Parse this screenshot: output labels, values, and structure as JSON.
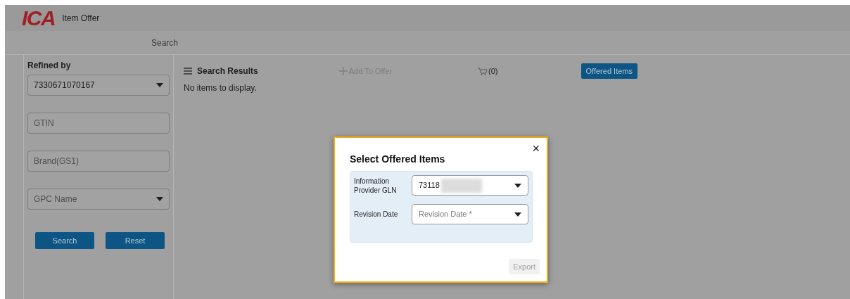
{
  "header": {
    "logo": "ICA",
    "title": "Item Offer"
  },
  "nav": {
    "label": "Search"
  },
  "sidebar": {
    "heading": "Refined by",
    "fields": [
      {
        "kind": "select",
        "value": "7330671070167"
      },
      {
        "kind": "text",
        "placeholder": "GTIN"
      },
      {
        "kind": "text",
        "placeholder": "Brand(GS1)"
      },
      {
        "kind": "select",
        "placeholder": "GPC Name"
      }
    ],
    "buttons": [
      "Search",
      "Reset"
    ]
  },
  "results": {
    "title": "Search Results",
    "add_to_offer": {
      "label": "Add To Offer",
      "disabled": true
    },
    "cart_count": "(0)",
    "offered_items": "Offered Items",
    "empty_text": "No items to display."
  },
  "dialog": {
    "title": "Select Offered Items",
    "close": "×",
    "fields": [
      {
        "label": "Information Provider GLN",
        "value": "73118",
        "redacted": true
      },
      {
        "label": "Revision Date",
        "placeholder": "Revision Date *"
      }
    ],
    "export": {
      "label": "Export",
      "disabled": true
    }
  }
}
